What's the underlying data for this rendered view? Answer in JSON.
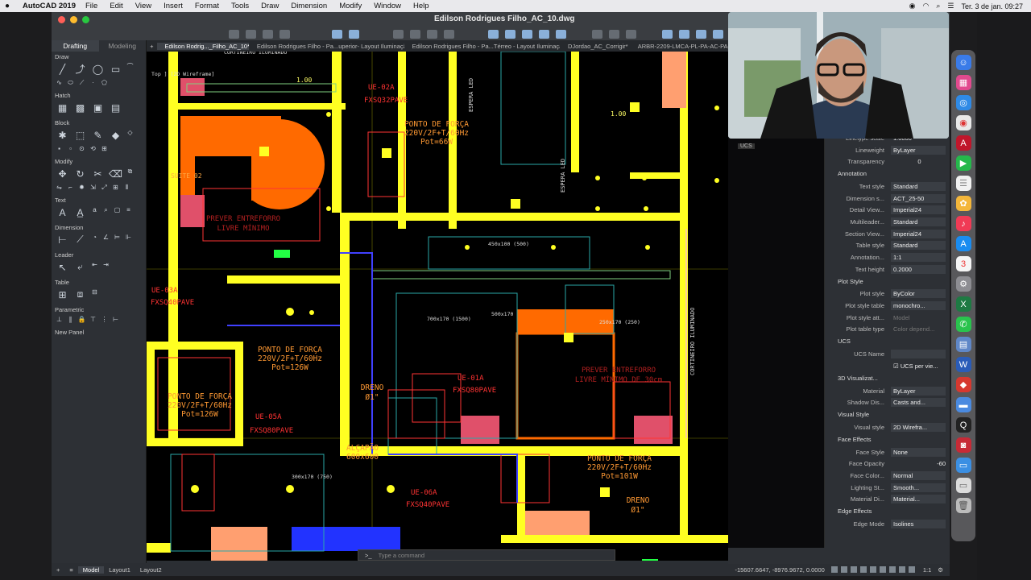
{
  "menubar": {
    "app": "AutoCAD 2019",
    "items": [
      "File",
      "Edit",
      "View",
      "Insert",
      "Format",
      "Tools",
      "Draw",
      "Dimension",
      "Modify",
      "Window",
      "Help"
    ],
    "datetime": "Ter. 3 de jan.  09:27"
  },
  "window": {
    "title": "Edilson Rodrigues Filho_AC_10.dwg"
  },
  "left_panel": {
    "tabs": [
      "Drafting",
      "Modeling"
    ],
    "sections": [
      "Draw",
      "Hatch",
      "Block",
      "Modify",
      "Text",
      "Dimension",
      "Leader",
      "Table",
      "Parametric",
      "New Panel"
    ]
  },
  "doc_tabs": [
    "Edilson Rodrig..._Filho_AC_10*",
    "Edilson Rodrigues Filho - Pa...uperior- Layout Iluminação*",
    "Edilson Rodrigues Filho - Pa...Térreo - Layout Iluminação*",
    "DJordao_AC_Corrigir*",
    "ARBR-2209-LMCA-PL-PA-AC-PA-"
  ],
  "drawing": {
    "labels": [
      "UE-02A",
      "FXSQ32PAVE",
      "UE-03A",
      "FXSQ40PAVE",
      "UE-01A",
      "FXSQ80PAVE",
      "UE-05A",
      "FXSQ80PAVE",
      "UE-06A",
      "FXSQ40PAVE"
    ],
    "ponto1": [
      "PONTO DE FORÇA",
      "220V/2F+T/60Hz",
      "Pot=66W"
    ],
    "ponto2": [
      "PONTO DE FORÇA",
      "220V/2F+T/60Hz",
      "Pot=126W"
    ],
    "ponto3": [
      "PONTO DE FORÇA",
      "220V/2F+T/60Hz",
      "Pot=126W"
    ],
    "ponto4": [
      "PONTO DE FORÇA",
      "220V/2F+T/60Hz",
      "Pot=101W"
    ],
    "alcapao": [
      "ALÇAPÃO",
      "600x600"
    ],
    "dreno": [
      "DRENO",
      "Ø1\""
    ],
    "prever": [
      "PREVER ENTREFORRO",
      "LIVRE MÍNIMO DE 30cm"
    ],
    "prever2": [
      "PREVER ENTREFORRO",
      "LIVRE MÍNIMO"
    ],
    "misc": [
      "CORTINEIRO ILUMINADO",
      "SUITE 02",
      "1.00",
      "1.00",
      "450x100 (500)",
      "700x170 (1500)",
      "500x170",
      "300x170 (750)",
      "250x170 (250)",
      "ESPERA LED",
      "ESPERA LED",
      "Top ] [2D Wireframe]"
    ]
  },
  "command": {
    "placeholder": "Type a command"
  },
  "status": {
    "tabs": [
      "Model",
      "Layout1",
      "Layout2"
    ],
    "coords": "-15607.6647, -8976.9672, 0.0000",
    "scale": "1:1"
  },
  "properties": {
    "top": [
      {
        "k": "Linetype scale",
        "v": "1.0000"
      },
      {
        "k": "Lineweight",
        "v": "ByLayer"
      },
      {
        "k": "Transparency",
        "v": "0"
      }
    ],
    "annotation": {
      "head": "Annotation",
      "rows": [
        {
          "k": "Text style",
          "v": "Standard"
        },
        {
          "k": "Dimension s...",
          "v": "ACT_25-50"
        },
        {
          "k": "Detail View...",
          "v": "Imperial24"
        },
        {
          "k": "Multileader...",
          "v": "Standard"
        },
        {
          "k": "Section View...",
          "v": "Imperial24"
        },
        {
          "k": "Table style",
          "v": "Standard"
        },
        {
          "k": "Annotation...",
          "v": "1:1"
        },
        {
          "k": "Text height",
          "v": "0.2000"
        }
      ]
    },
    "plot": {
      "head": "Plot Style",
      "rows": [
        {
          "k": "Plot style",
          "v": "ByColor"
        },
        {
          "k": "Plot style table",
          "v": "monochro..."
        },
        {
          "k": "Plot style att...",
          "v": "Model"
        },
        {
          "k": "Plot table type",
          "v": "Color depend..."
        }
      ]
    },
    "ucs": {
      "head": "UCS",
      "rows": [
        {
          "k": "UCS Name",
          "v": ""
        },
        {
          "k": "",
          "v": "UCS per vie..."
        }
      ]
    },
    "viz": {
      "head": "3D Visualizat...",
      "rows": [
        {
          "k": "Material",
          "v": "ByLayer"
        },
        {
          "k": "Shadow Dis...",
          "v": "Casts and..."
        }
      ]
    },
    "visual": {
      "head": "Visual Style",
      "rows": [
        {
          "k": "Visual style",
          "v": "2D Wirefra..."
        }
      ]
    },
    "face": {
      "head": "Face Effects",
      "rows": [
        {
          "k": "Face Style",
          "v": "None"
        },
        {
          "k": "Face Opacity",
          "v": "-60"
        },
        {
          "k": "Face Color...",
          "v": "Normal"
        },
        {
          "k": "Lighting St...",
          "v": "Smooth..."
        },
        {
          "k": "Material Di...",
          "v": "Material..."
        }
      ]
    },
    "edge": {
      "head": "Edge Effects",
      "rows": [
        {
          "k": "Edge Mode",
          "v": "Isolines"
        }
      ]
    },
    "ucs_tag": "UCS"
  }
}
